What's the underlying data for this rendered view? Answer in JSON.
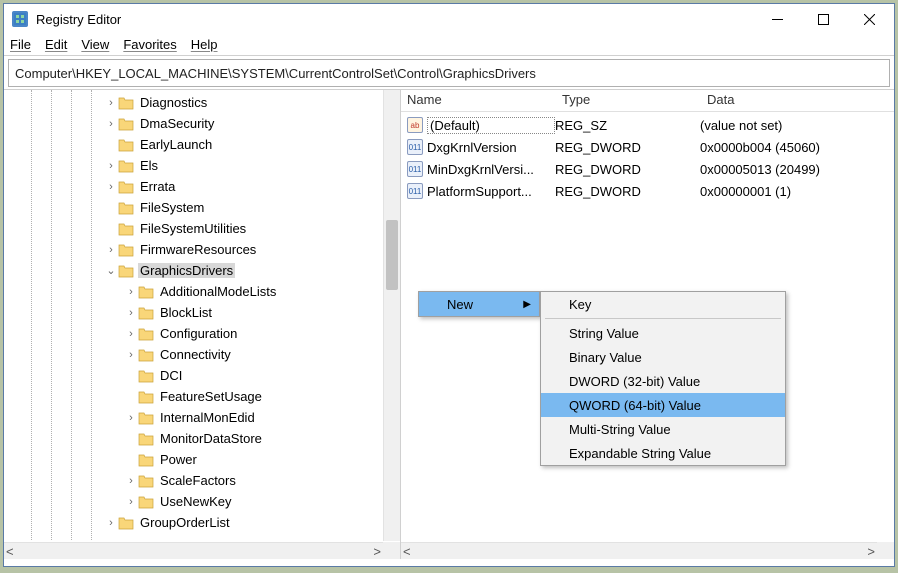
{
  "title": "Registry Editor",
  "menu": {
    "file": "File",
    "edit": "Edit",
    "view": "View",
    "favorites": "Favorites",
    "help": "Help"
  },
  "address": "Computer\\HKEY_LOCAL_MACHINE\\SYSTEM\\CurrentControlSet\\Control\\GraphicsDrivers",
  "tree": [
    {
      "indent": 3,
      "exp": ">",
      "label": "Diagnostics"
    },
    {
      "indent": 3,
      "exp": ">",
      "label": "DmaSecurity"
    },
    {
      "indent": 3,
      "exp": "",
      "label": "EarlyLaunch"
    },
    {
      "indent": 3,
      "exp": ">",
      "label": "Els"
    },
    {
      "indent": 3,
      "exp": ">",
      "label": "Errata"
    },
    {
      "indent": 3,
      "exp": "",
      "label": "FileSystem"
    },
    {
      "indent": 3,
      "exp": "",
      "label": "FileSystemUtilities"
    },
    {
      "indent": 3,
      "exp": ">",
      "label": "FirmwareResources"
    },
    {
      "indent": 3,
      "exp": "v",
      "label": "GraphicsDrivers",
      "sel": true
    },
    {
      "indent": 4,
      "exp": ">",
      "label": "AdditionalModeLists"
    },
    {
      "indent": 4,
      "exp": ">",
      "label": "BlockList"
    },
    {
      "indent": 4,
      "exp": ">",
      "label": "Configuration"
    },
    {
      "indent": 4,
      "exp": ">",
      "label": "Connectivity"
    },
    {
      "indent": 4,
      "exp": "",
      "label": "DCI"
    },
    {
      "indent": 4,
      "exp": "",
      "label": "FeatureSetUsage"
    },
    {
      "indent": 4,
      "exp": ">",
      "label": "InternalMonEdid"
    },
    {
      "indent": 4,
      "exp": "",
      "label": "MonitorDataStore"
    },
    {
      "indent": 4,
      "exp": "",
      "label": "Power"
    },
    {
      "indent": 4,
      "exp": ">",
      "label": "ScaleFactors"
    },
    {
      "indent": 4,
      "exp": ">",
      "label": "UseNewKey"
    },
    {
      "indent": 3,
      "exp": ">",
      "label": "GroupOrderList"
    }
  ],
  "cols": {
    "name": "Name",
    "type": "Type",
    "data": "Data"
  },
  "values": [
    {
      "icon": "ab",
      "name": "(Default)",
      "type": "REG_SZ",
      "data": "(value not set)",
      "sel": true
    },
    {
      "icon": "bin",
      "name": "DxgKrnlVersion",
      "type": "REG_DWORD",
      "data": "0x0000b004 (45060)"
    },
    {
      "icon": "bin",
      "name": "MinDxgKrnlVersi...",
      "type": "REG_DWORD",
      "data": "0x00005013 (20499)"
    },
    {
      "icon": "bin",
      "name": "PlatformSupport...",
      "type": "REG_DWORD",
      "data": "0x00000001 (1)"
    }
  ],
  "ctx1": {
    "new": "New"
  },
  "ctx2": {
    "key": "Key",
    "string": "String Value",
    "binary": "Binary Value",
    "dword": "DWORD (32-bit) Value",
    "qword": "QWORD (64-bit) Value",
    "multi": "Multi-String Value",
    "expand": "Expandable String Value"
  }
}
